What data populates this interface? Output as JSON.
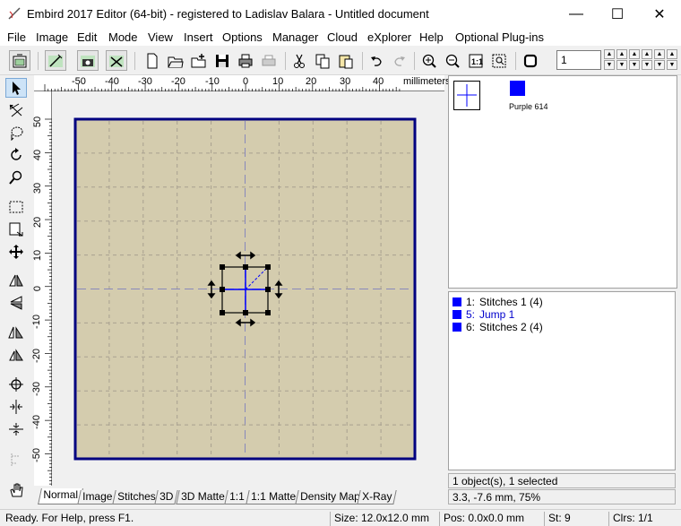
{
  "window": {
    "title": "Embird 2017 Editor (64-bit) - registered to Ladislav Balara - Untitled document",
    "minimize": "—",
    "maximize": "☐",
    "close": "✕"
  },
  "menu": [
    "File",
    "Image",
    "Edit",
    "Mode",
    "View",
    "Insert",
    "Options",
    "Manager",
    "Cloud",
    "eXplorer",
    "Help",
    "Optional Plug-ins"
  ],
  "toolbar": {
    "buttons": [
      "import-hoop-icon",
      "stitch-wand-icon",
      "camera-icon",
      "no-stitch-icon",
      "new-file-icon",
      "open-file-icon",
      "add-file-icon",
      "save-icon",
      "print-icon",
      "print-preview-icon",
      "cut-icon",
      "copy-icon",
      "paste-icon",
      "undo-icon",
      "redo-icon",
      "zoom-in-icon",
      "zoom-out-icon",
      "zoom-1to1-icon",
      "zoom-fit-icon",
      "hoop-icon"
    ],
    "stitch_number": "1"
  },
  "left_tools": [
    "select-arrow-icon",
    "edit-stitches-icon",
    "lasso-icon",
    "rotate-icon",
    "zoom-tool-icon",
    "rect-select-icon",
    "resize-icon",
    "move-icon",
    "mirror-horizontal-icon",
    "mirror-vertical-icon",
    "skew-left-icon",
    "skew-right-icon",
    "center-icon",
    "align-vertical-icon",
    "align-horizontal-icon",
    "disabled-tool-icon",
    "hand-tool-icon"
  ],
  "ruler": {
    "top_labels": [
      "-50",
      "-40",
      "-30",
      "-20",
      "-10",
      "0",
      "10",
      "20",
      "30",
      "40"
    ],
    "unit": "millimeters",
    "left_labels": [
      "50",
      "40",
      "30",
      "20",
      "10",
      "0",
      "-10",
      "-20",
      "-30",
      "-40",
      "-50"
    ]
  },
  "colors": {
    "hoop_fill": "#d4ccae",
    "hoop_border": "#000080",
    "stitch_color": "#0000ff"
  },
  "palette": {
    "swatch_color": "#0000ff",
    "swatch_label": "Purple 614"
  },
  "objects": [
    {
      "num": "1:",
      "name": "Stitches 1 (4)",
      "link": false
    },
    {
      "num": "5:",
      "name": "Jump 1",
      "link": true
    },
    {
      "num": "6:",
      "name": "Stitches 2 (4)",
      "link": false
    }
  ],
  "selection_status": "1 object(s), 1 selected",
  "position_status": "3.3, -7.6 mm, 75%",
  "tabs": [
    "Normal",
    "Image",
    "Stitches",
    "3D",
    "3D Matte",
    "1:1",
    "1:1 Matte",
    "Density Map",
    "X-Ray"
  ],
  "statusbar": {
    "help": "Ready. For Help, press F1.",
    "size": "Size: 12.0x12.0 mm",
    "pos": "Pos: 0.0x0.0 mm",
    "st": "St: 9",
    "clrs": "Clrs: 1/1"
  }
}
